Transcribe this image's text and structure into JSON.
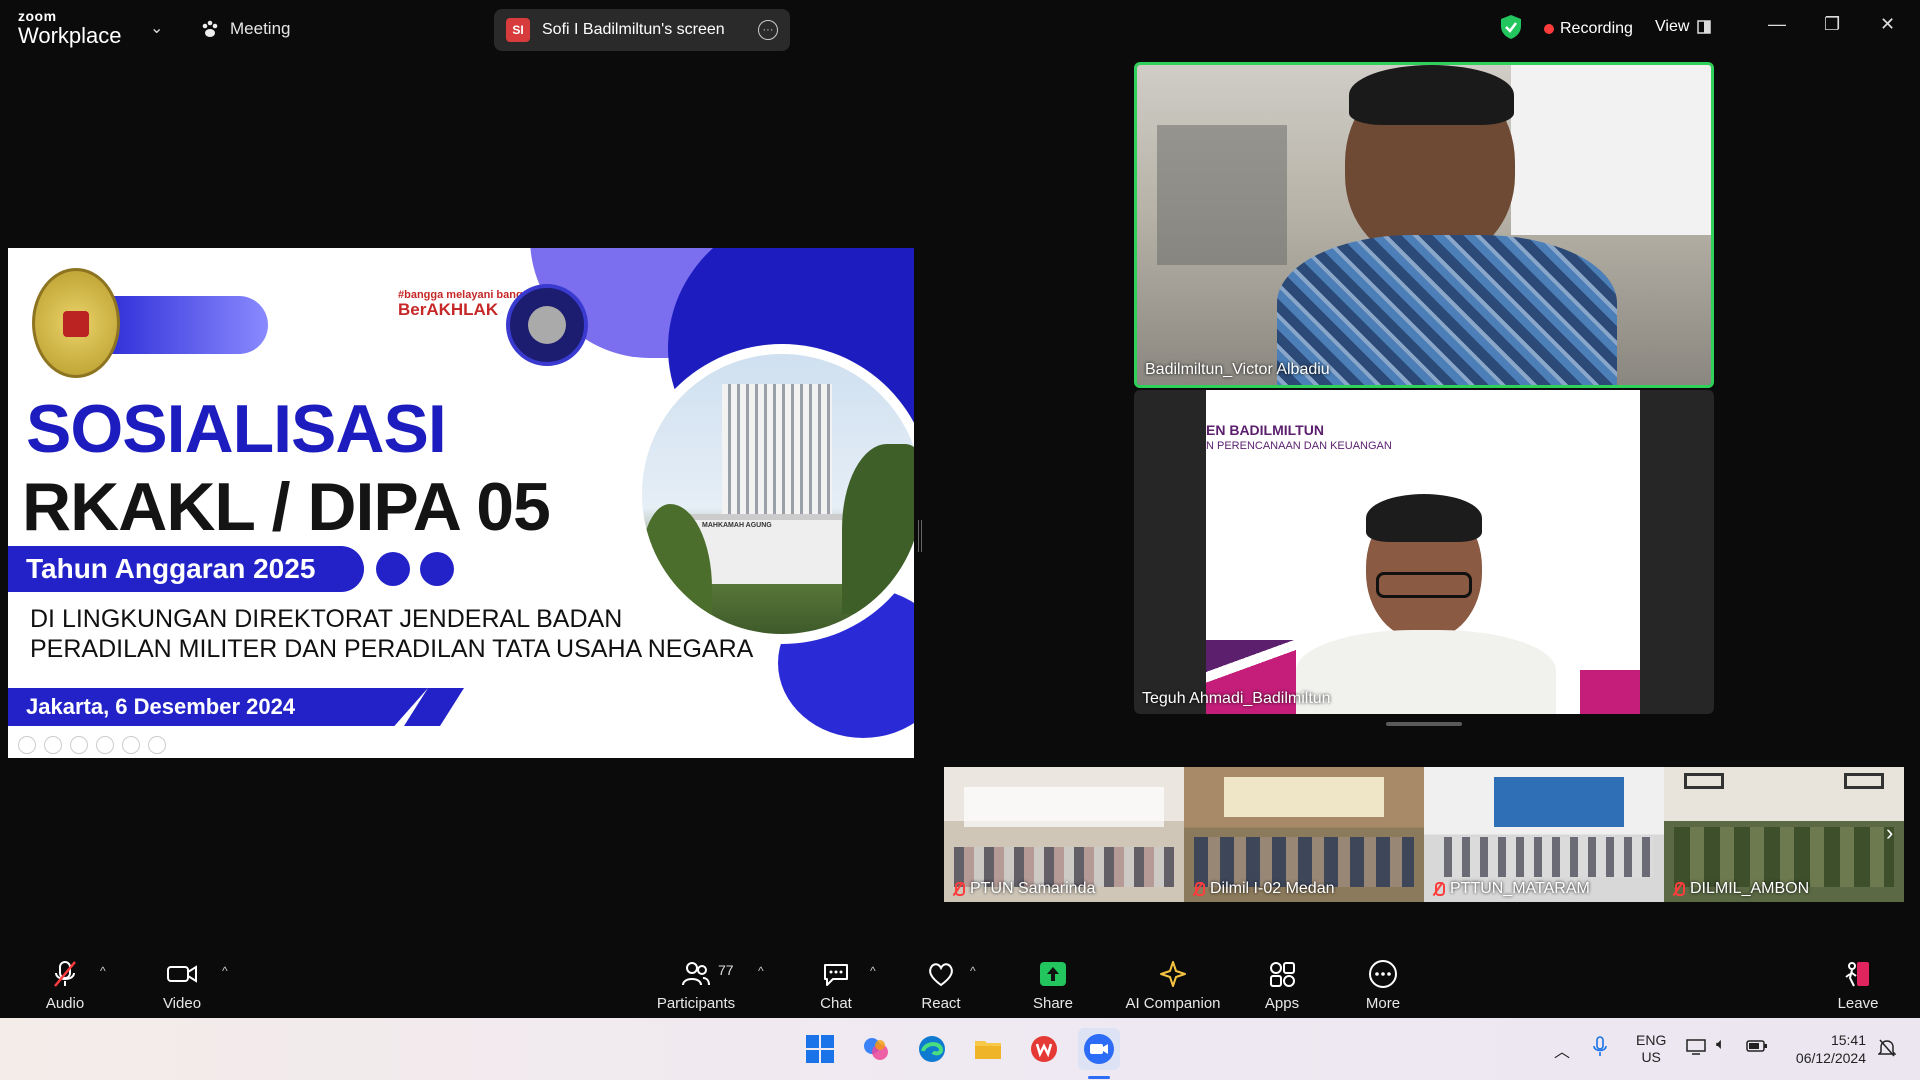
{
  "titlebar": {
    "brand_top": "zoom",
    "brand_bottom": "Workplace",
    "meeting_label": "Meeting",
    "share_badge": "SI",
    "share_label": "Sofi I Badilmiltun's screen",
    "recording_label": "Recording",
    "view_label": "View"
  },
  "slide": {
    "akhlak_tag": "#bangga melayani bangsa",
    "akhlak_brand": "BerAKHLAK",
    "title_line1": "SOSIALISASI",
    "title_line2": "RKAKL / DIPA 05",
    "year_banner": "Tahun Anggaran 2025",
    "subtitle_line1": "DI LINGKUNGAN DIREKTORAT JENDERAL BADAN",
    "subtitle_line2": "PERADILAN MILITER DAN PERADILAN TATA USAHA NEGARA",
    "date_banner": "Jakarta, 6 Desember 2024",
    "building_sign": "MAHKAMAH AGUNG"
  },
  "tiles": {
    "speaker_name": "Badilmiltun_Victor Albadiu",
    "second_name": "Teguh Ahmadi_Badilmiltun",
    "second_bg_line1": "EN BADILMILTUN",
    "second_bg_line2": "N PERENCANAAN DAN KEUANGAN"
  },
  "thumbnails": [
    {
      "name": "PTUN Samarinda"
    },
    {
      "name": "Dilmil I-02 Medan"
    },
    {
      "name": "PTTUN_MATARAM"
    },
    {
      "name": "DILMIL_AMBON"
    }
  ],
  "toolbar": {
    "audio": "Audio",
    "video": "Video",
    "participants": "Participants",
    "participants_count": "77",
    "chat": "Chat",
    "react": "React",
    "share": "Share",
    "ai": "AI Companion",
    "apps": "Apps",
    "more": "More",
    "leave": "Leave"
  },
  "taskbar": {
    "lang1": "ENG",
    "lang2": "US",
    "time": "15:41",
    "date": "06/12/2024"
  },
  "colors": {
    "accent_green": "#2fd15a",
    "slide_blue": "#2322c9",
    "recording_red": "#ff3b3b",
    "leave_red": "#e0245e"
  }
}
